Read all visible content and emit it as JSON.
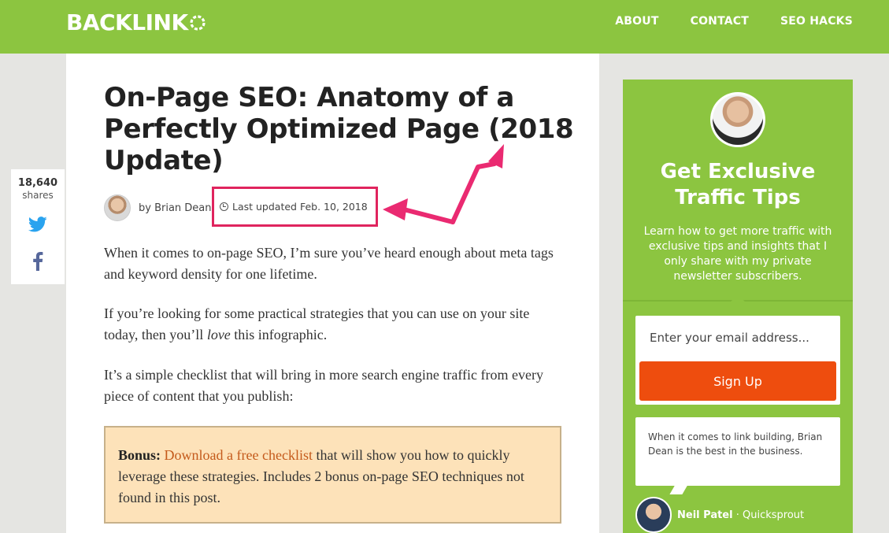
{
  "header": {
    "logo": "BACKLINK",
    "nav": [
      "ABOUT",
      "CONTACT",
      "SEO HACKS"
    ]
  },
  "article": {
    "title": "On-Page SEO: Anatomy of a Perfectly Optimized Page (2018 Update)",
    "author": "by Brian Dean",
    "last_updated": "Last updated Feb. 10, 2018",
    "paragraphs": [
      "When it comes to on-page SEO, I’m sure you’ve heard enough about meta tags and keyword density for one lifetime.",
      "If you’re looking for some practical strategies that you can use on your site today, then you’ll ",
      "love",
      " this infographic.",
      "It’s a simple checklist that will bring in more search engine traffic from every piece of content that you publish:"
    ],
    "bonus": {
      "label": "Bonus:",
      "link": "Download a free checklist",
      "text": " that will show you how to quickly leverage these strategies. Includes 2 bonus on-page SEO techniques not found in this post."
    }
  },
  "share": {
    "count": "18,640",
    "label": "shares"
  },
  "sidebar": {
    "title": "Get Exclusive Traffic Tips",
    "description": "Learn how to get more traffic with exclusive tips and insights that I only share with my private newsletter subscribers.",
    "email_placeholder": "Enter your email address...",
    "signup_label": "Sign Up",
    "quote": "When it comes to link building, Brian Dean is the best in the business.",
    "quoter_name": "Neil Patel",
    "quoter_sep": " · ",
    "quoter_company": "Quicksprout"
  },
  "colors": {
    "brand_green": "#8cc540",
    "signup_orange": "#ee4d0e",
    "highlight_pink": "#e0245e",
    "bonus_bg": "#fde2b9"
  }
}
